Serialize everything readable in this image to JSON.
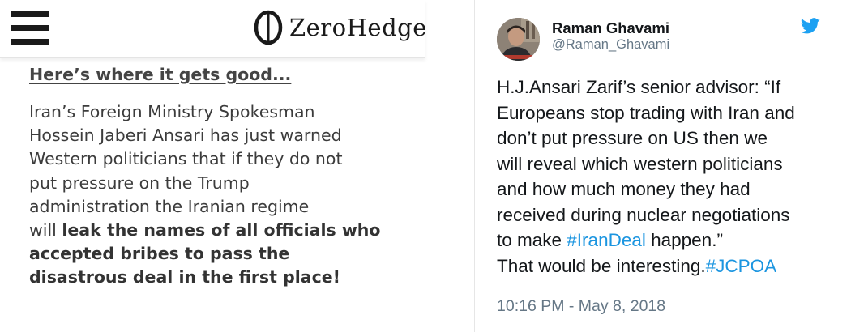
{
  "left_panel": {
    "site_name": "ZeroHedge",
    "headline": "Here’s where it gets good...",
    "body": {
      "line1": "Iran’s Foreign Ministry Spokesman",
      "line2": "Hossein Jaberi Ansari has just warned",
      "line3": "Western politicians that if they do not",
      "line4": "put pressure on the Trump",
      "line5": "administration the Iranian regime",
      "line6_plain": "will ",
      "line6_bold": "leak the names of all officials who",
      "line7_bold": "accepted bribes to pass the",
      "line8_bold": "disastrous deal in the first place!"
    }
  },
  "tweet": {
    "display_name": "Raman Ghavami",
    "handle": "@Raman_Ghavami",
    "text": {
      "line1": "H.J.Ansari Zarif’s senior advisor: “If",
      "line2": "Europeans stop trading with Iran and",
      "line3": "don’t put pressure on US then we",
      "line4": "will reveal which western politicians",
      "line5": "and how much money they had",
      "line6": "received during nuclear negotiations",
      "line7_before": "to make ",
      "line7_hashtag": "#IranDeal",
      "line7_after": " happen.”",
      "line8_before": "That would be interesting.",
      "line8_hashtag": "#JCPOA"
    },
    "timestamp": "10:16 PM - May 8, 2018"
  },
  "icons": {
    "menu": "hamburger-menu-icon",
    "logo": "zerohedge-logo-icon",
    "bird": "twitter-bird-icon"
  },
  "colors": {
    "hashtag": "#1b95e0",
    "twitter_blue": "#1da1f2",
    "body_text": "#3c3c3c",
    "handle_gray": "#657786"
  }
}
